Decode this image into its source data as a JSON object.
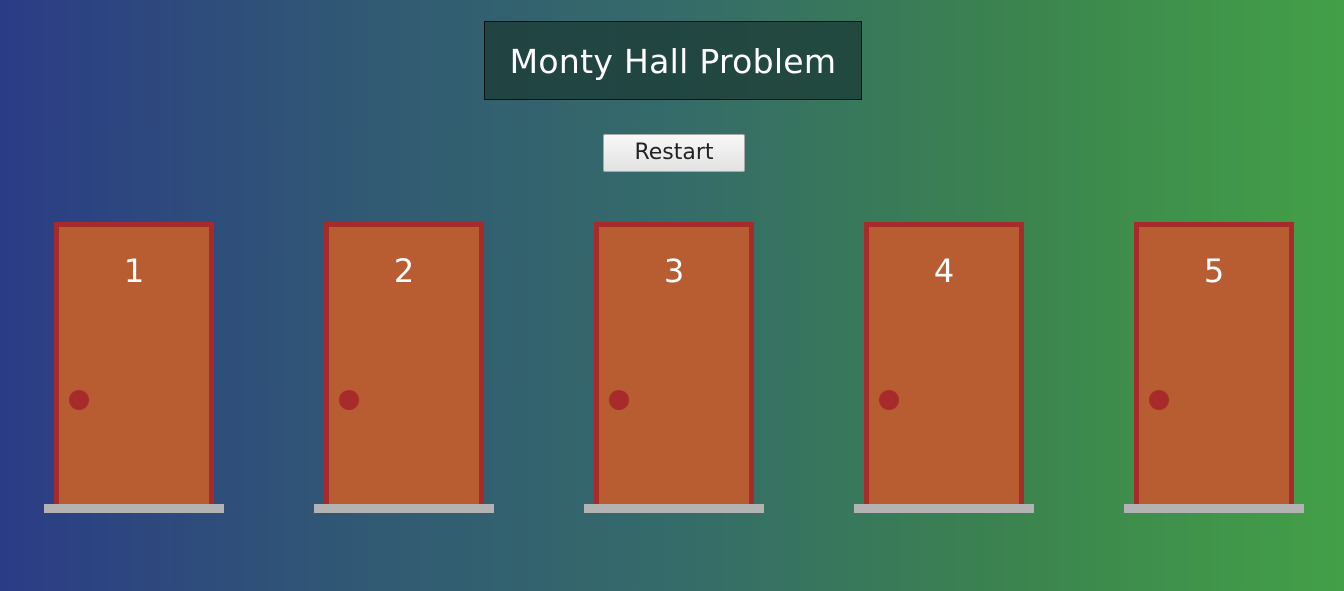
{
  "header": {
    "title": "Monty Hall Problem"
  },
  "controls": {
    "restart_label": "Restart"
  },
  "doors": [
    {
      "number": "1"
    },
    {
      "number": "2"
    },
    {
      "number": "3"
    },
    {
      "number": "4"
    },
    {
      "number": "5"
    }
  ],
  "colors": {
    "door": "#b85c32",
    "door_frame": "#a82b2b",
    "knob": "#a82b2b",
    "threshold": "#b3b3b3",
    "background_left": "#2b3c86",
    "background_right": "#43a047"
  }
}
